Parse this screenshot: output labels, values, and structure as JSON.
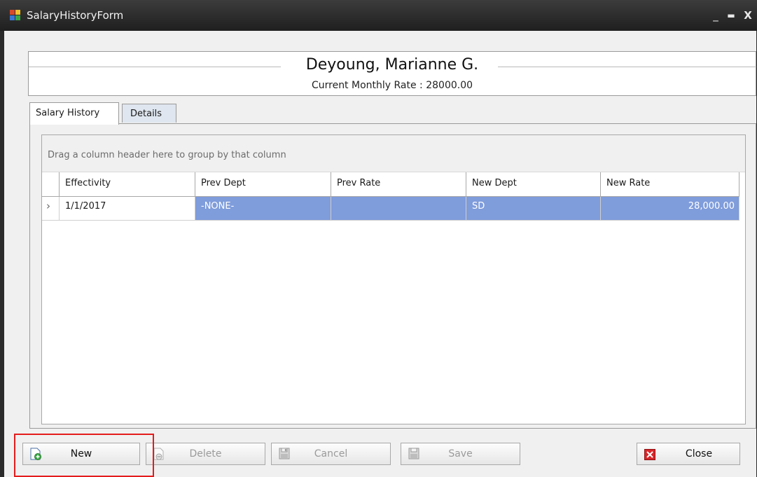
{
  "window": {
    "title": "SalaryHistoryForm",
    "minimize": "_",
    "maximize": "▬",
    "close": "X"
  },
  "header": {
    "employee_name": "Deyoung, Marianne G.",
    "rate_text": "Current Monthly Rate : 28000.00"
  },
  "tabs": [
    {
      "label": "Salary History",
      "active": true
    },
    {
      "label": "Details",
      "active": false
    }
  ],
  "grid": {
    "group_panel_text": "Drag a column header here to group by that column",
    "columns": [
      "Effectivity",
      "Prev Dept",
      "Prev Rate",
      "New Dept",
      "New Rate"
    ],
    "rows": [
      {
        "indicator": "›",
        "effectivity": "1/1/2017",
        "prev_dept": "-NONE-",
        "prev_rate": "",
        "new_dept": "SD",
        "new_rate": "28,000.00"
      }
    ]
  },
  "buttons": {
    "new": {
      "label": "New",
      "icon": "new-document-icon",
      "enabled": true
    },
    "delete": {
      "label": "Delete",
      "icon": "delete-document-icon",
      "enabled": false
    },
    "cancel": {
      "label": "Cancel",
      "icon": "cancel-disk-icon",
      "enabled": false
    },
    "save": {
      "label": "Save",
      "icon": "save-disk-icon",
      "enabled": false
    },
    "close": {
      "label": "Close",
      "icon": "red-x-icon",
      "enabled": true
    }
  },
  "colors": {
    "selection": "#7f9cdb",
    "highlight_box": "#e41c1c",
    "titlebar": "#2b2b2b"
  }
}
